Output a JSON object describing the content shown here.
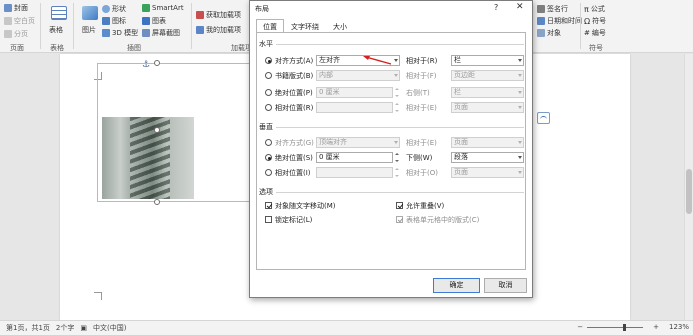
{
  "ribbon": {
    "col1": {
      "items": [
        "封面",
        "空白页",
        "分页"
      ],
      "group": "页面"
    },
    "table": {
      "label": "表格",
      "group": "表格"
    },
    "illustrations": {
      "picture": "图片",
      "shapes": "形状",
      "icons": "图标",
      "model3d": "3D 模型",
      "smartart": "SmartArt",
      "chart": "图表",
      "screenshot": "屏幕截图",
      "group": "插图"
    },
    "addins": {
      "get": "获取加载项",
      "my": "我的加载项",
      "group": "加载项"
    },
    "right": {
      "signature": "签名行",
      "datetime": "日期和时间",
      "object": "对象",
      "equation": "公式",
      "symbol": "符号",
      "number": "编号",
      "group": "符号"
    }
  },
  "dialog": {
    "title": "布局",
    "help": "?",
    "close": "✕",
    "tabs": [
      "位置",
      "文字环绕",
      "大小"
    ],
    "horizontal": {
      "label": "水平",
      "alignment": {
        "label": "对齐方式(A)",
        "value": "左对齐",
        "relative_label": "相对于(R)",
        "relative_value": "栏"
      },
      "book_layout": {
        "label": "书籍版式(B)",
        "value": "内部",
        "relative_label": "相对于(F)",
        "relative_value": "页边距"
      },
      "absolute": {
        "label": "绝对位置(P)",
        "value": "0 厘米",
        "relative_label": "右侧(T)",
        "relative_value": "栏"
      },
      "relative": {
        "label": "相对位置(R)",
        "value": "",
        "relative_label": "相对于(E)",
        "relative_value": "页面"
      }
    },
    "vertical": {
      "label": "垂直",
      "alignment": {
        "label": "对齐方式(G)",
        "value": "顶端对齐",
        "relative_label": "相对于(E)",
        "relative_value": "页面"
      },
      "absolute": {
        "label": "绝对位置(S)",
        "value": "0 厘米",
        "relative_label": "下侧(W)",
        "relative_value": "段落"
      },
      "relative": {
        "label": "相对位置(I)",
        "value": "",
        "relative_label": "相对于(O)",
        "relative_value": "页面"
      }
    },
    "options": {
      "label": "选项",
      "move_with_text": "对象随文字移动(M)",
      "lock_anchor": "锁定标记(L)",
      "allow_overlap": "允许重叠(V)",
      "layout_in_cell": "表格单元格中的版式(C)"
    },
    "ok": "确定",
    "cancel": "取消"
  },
  "statusbar": {
    "page": "第1页，共1页",
    "words": "2个字",
    "language": "中文(中国)",
    "zoom": "123%"
  }
}
